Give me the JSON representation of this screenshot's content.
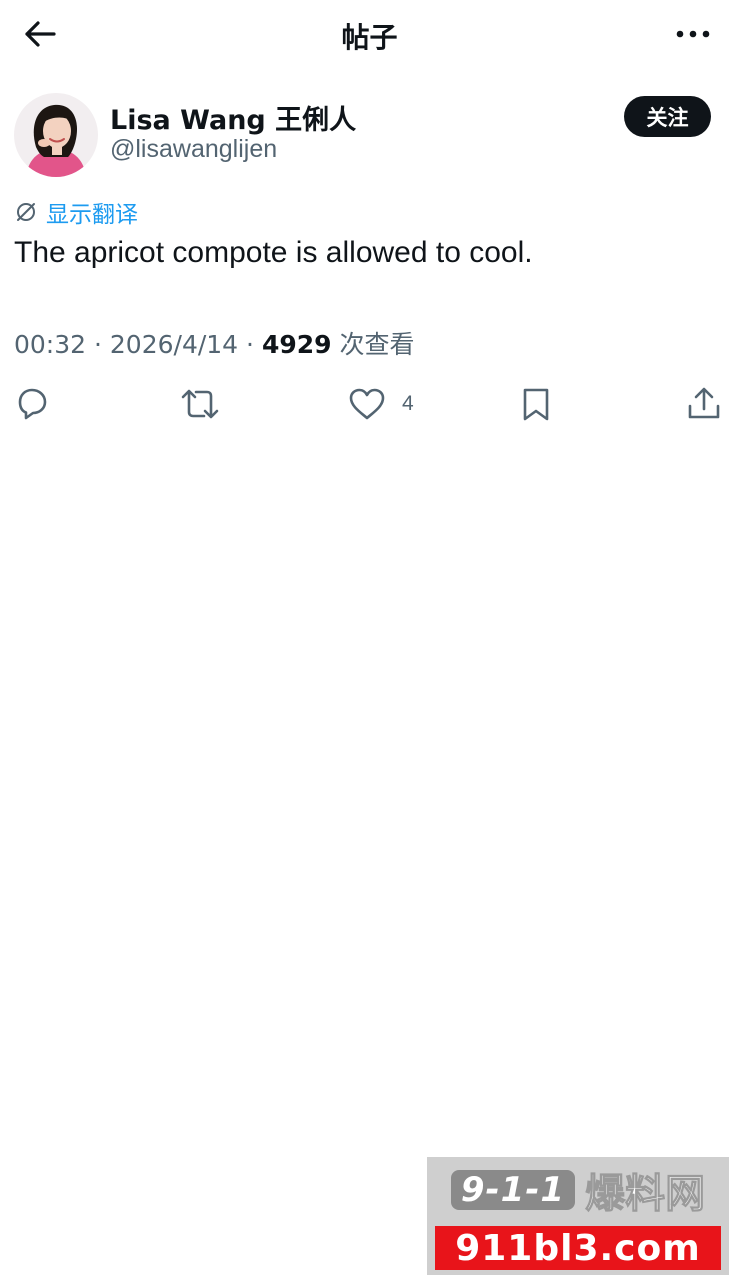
{
  "header": {
    "title": "帖子",
    "back_icon": "arrow-left-icon",
    "more_icon": "more-horizontal-icon"
  },
  "post": {
    "author": {
      "display_name": "Lisa Wang 王俐人",
      "handle": "@lisawanglijen",
      "avatar_icon": "avatar-photo"
    },
    "follow_label": "关注",
    "translate_label": "显示翻译",
    "translate_icon": "translate-icon",
    "text": "The apricot compote is allowed to cool.",
    "time": "00:32",
    "separator": "·",
    "date": "2026/4/14",
    "views_count": "4929",
    "views_label": "次查看"
  },
  "actions": {
    "reply_icon": "reply-icon",
    "repost_icon": "repost-icon",
    "like_icon": "heart-icon",
    "like_count": "4",
    "bookmark_icon": "bookmark-icon",
    "share_icon": "share-icon"
  },
  "watermark": {
    "badge_text": "9-1-1",
    "chinese_text": "爆料网",
    "domain_text": "911bl3.com"
  },
  "colors": {
    "text_primary": "#0f1419",
    "text_secondary": "#536471",
    "link_blue": "#1d9bf0",
    "follow_button_bg": "#0f1419",
    "watermark_red": "#e8141a"
  }
}
